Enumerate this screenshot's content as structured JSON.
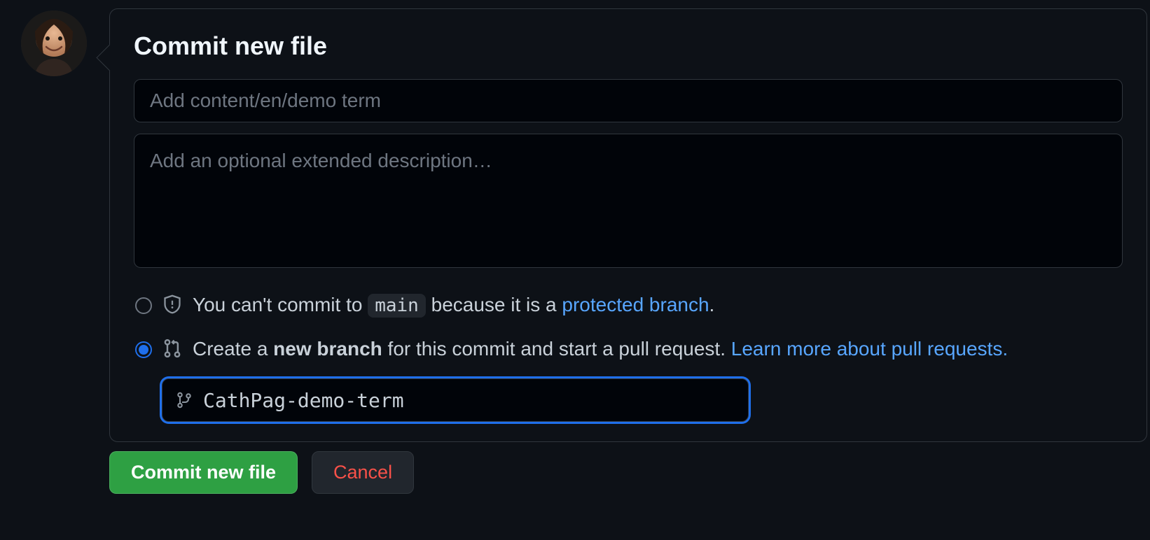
{
  "form": {
    "title": "Commit new file",
    "summary_placeholder": "Add content/en/demo term",
    "summary_value": "",
    "description_placeholder": "Add an optional extended description…",
    "description_value": ""
  },
  "option_protected": {
    "pre": "You can't commit to ",
    "code": "main",
    "mid": " because it is a ",
    "link": "protected branch",
    "post": "."
  },
  "option_newbranch": {
    "a": "Create a ",
    "b": "new branch",
    "c": " for this commit and start a pull request. ",
    "learn": "Learn more about pull requests."
  },
  "branch": {
    "value": "CathPag-demo-term",
    "placeholder": ""
  },
  "buttons": {
    "commit": "Commit new file",
    "cancel": "Cancel"
  }
}
